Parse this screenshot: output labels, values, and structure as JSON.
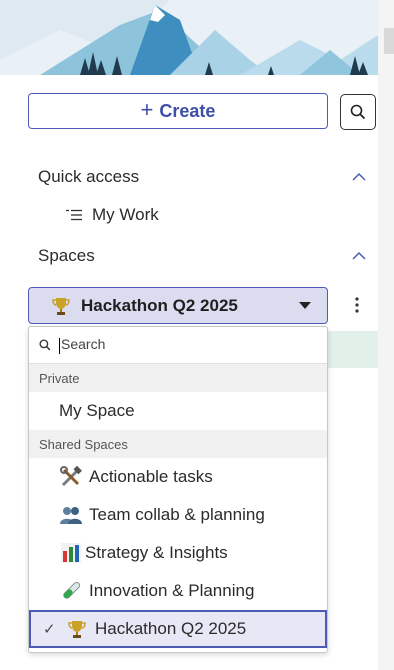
{
  "create_button": {
    "label": "Create",
    "icon": "plus-icon"
  },
  "search_button": {
    "icon": "search-icon"
  },
  "quick_access": {
    "label": "Quick access",
    "items": [
      {
        "label": "My Work",
        "icon": "list-icon"
      }
    ]
  },
  "spaces": {
    "label": "Spaces",
    "selected": {
      "label": "Hackathon Q2 2025",
      "icon": "trophy-icon"
    }
  },
  "dropdown": {
    "search_placeholder": "Search",
    "groups": [
      {
        "label": "Private",
        "items": [
          {
            "label": "My Space"
          }
        ]
      },
      {
        "label": "Shared Spaces",
        "items": [
          {
            "label": "Actionable tasks",
            "icon": "tools-icon"
          },
          {
            "label": "Team collab & planning",
            "icon": "people-icon"
          },
          {
            "label": "Strategy & Insights",
            "icon": "bar-chart-icon"
          },
          {
            "label": "Innovation & Planning",
            "icon": "test-tube-icon"
          },
          {
            "label": "Hackathon Q2 2025",
            "icon": "trophy-icon",
            "selected": true
          }
        ]
      }
    ]
  },
  "colors": {
    "accent": "#4e5bb5",
    "selected_bg": "#dcdcf0"
  }
}
